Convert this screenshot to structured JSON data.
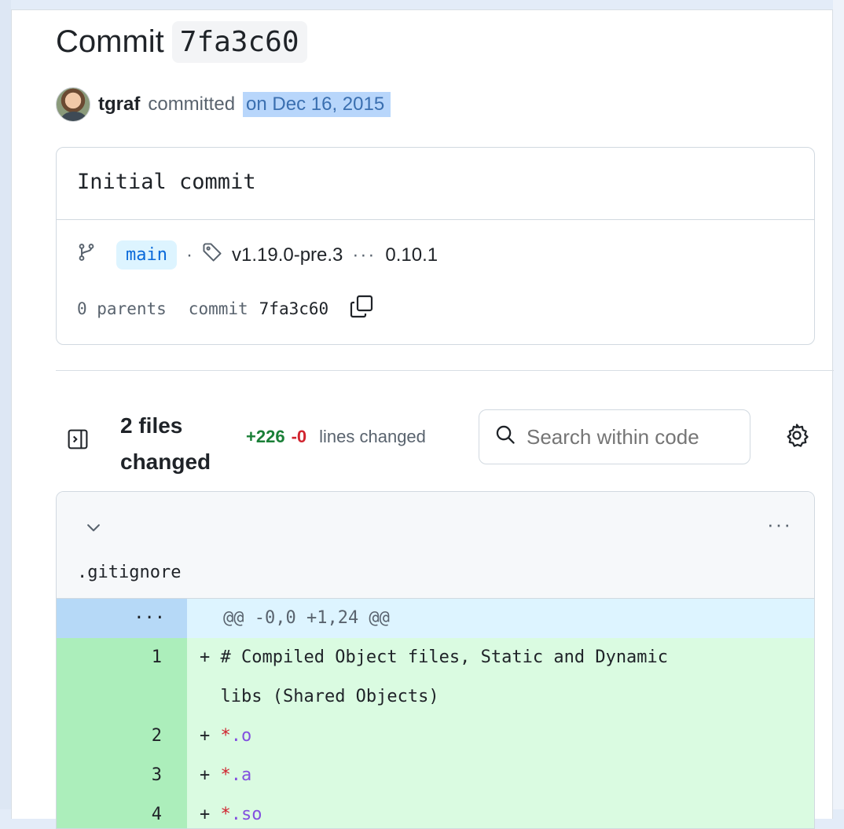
{
  "commit": {
    "title_prefix": "Commit",
    "sha": "7fa3c60",
    "author": "tgraf",
    "action": "committed",
    "date": "on Dec 16, 2015",
    "message": "Initial commit",
    "branch": "main",
    "tag": "v1.19.0-pre.3",
    "more_tags": "···",
    "oldest_tag": "0.10.1",
    "parents": "0 parents",
    "commit_label": "commit",
    "commit_sha": "7fa3c60"
  },
  "files_bar": {
    "count_label": "2 files changed",
    "additions": "+226",
    "deletions": "-0",
    "lines_label": "lines changed",
    "search_placeholder": "Search within code"
  },
  "file": {
    "name": ".gitignore",
    "more_label": "···",
    "hunk_ln": "···",
    "hunk_header": "@@ -0,0 +1,24 @@",
    "lines": [
      {
        "num": "1",
        "prefix": "+ ",
        "text": "# Compiled Object files, Static and Dynamic"
      },
      {
        "num": "",
        "prefix": "  ",
        "text": "libs (Shared Objects)"
      },
      {
        "num": "2",
        "prefix": "+ ",
        "sym": "*",
        "ext": ".o"
      },
      {
        "num": "3",
        "prefix": "+ ",
        "sym": "*",
        "ext": ".a"
      },
      {
        "num": "4",
        "prefix": "+ ",
        "sym": "*",
        "ext": ".so"
      }
    ]
  },
  "icons": {
    "branch": "git-branch-icon",
    "tag": "tag-icon",
    "copy": "copy-icon",
    "sidebar_toggle": "sidebar-toggle-icon",
    "search": "search-icon",
    "settings": "gear-icon",
    "collapse": "chevron-down-icon"
  },
  "colors": {
    "addition": "#1a7f37",
    "deletion": "#d1242f",
    "link": "#0969da",
    "selection": "#b8d6fb"
  }
}
